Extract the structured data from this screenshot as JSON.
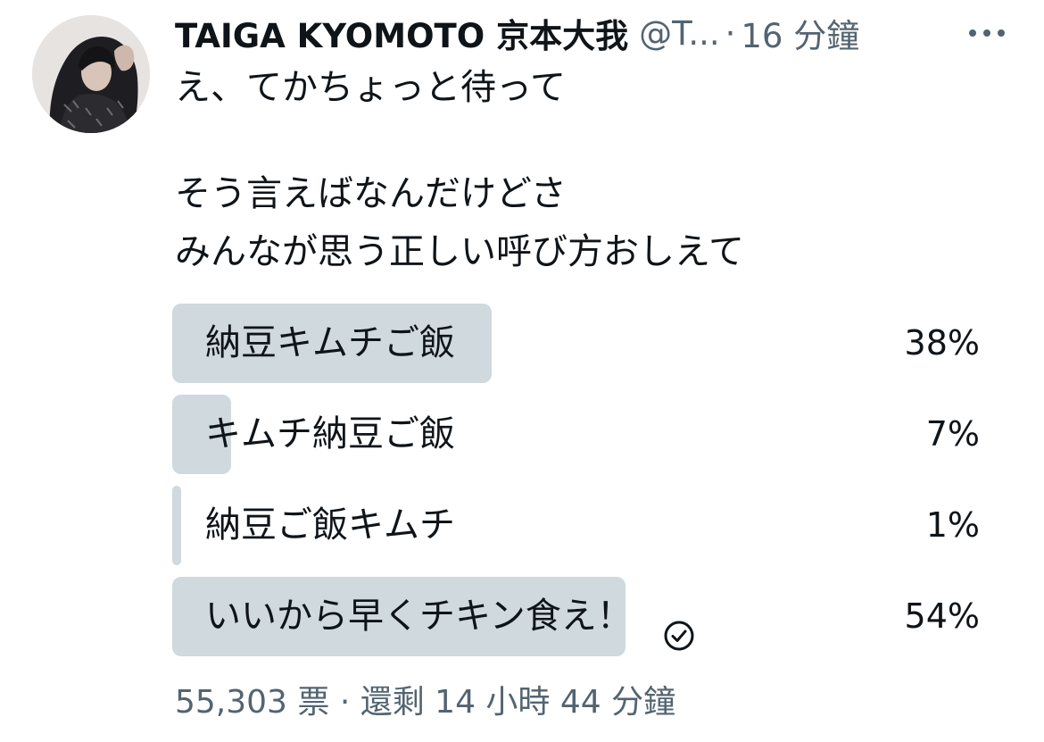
{
  "tweet": {
    "author": {
      "display_name": "TAIGA KYOMOTO 京本大我",
      "handle": "@T...",
      "avatar_icon": "profile-photo"
    },
    "time_separator": "·",
    "timestamp": "16 分鐘",
    "more_icon": "more-horizontal-icon",
    "text_lines": [
      "え、てかちょっと待って",
      "そう言えばなんだけどさ",
      "みんなが思う正しい呼び方おしえて"
    ]
  },
  "poll": {
    "options": [
      {
        "label": "納豆キムチご飯",
        "percent_text": "38%",
        "percent": 38,
        "selected": false
      },
      {
        "label": "キムチ納豆ご飯",
        "percent_text": "7%",
        "percent": 7,
        "selected": false
      },
      {
        "label": "納豆ご飯キムチ",
        "percent_text": "1%",
        "percent": 1,
        "selected": false
      },
      {
        "label": "いいから早くチキン食え！",
        "percent_text": "54%",
        "percent": 54,
        "selected": true
      }
    ],
    "footer": "55,303 票 · 還剩 14 小時 44 分鐘",
    "selected_icon": "check-circle-icon"
  },
  "colors": {
    "poll_bar": "#cfd9de",
    "secondary_text": "#536471",
    "primary_text": "#0f1419"
  }
}
